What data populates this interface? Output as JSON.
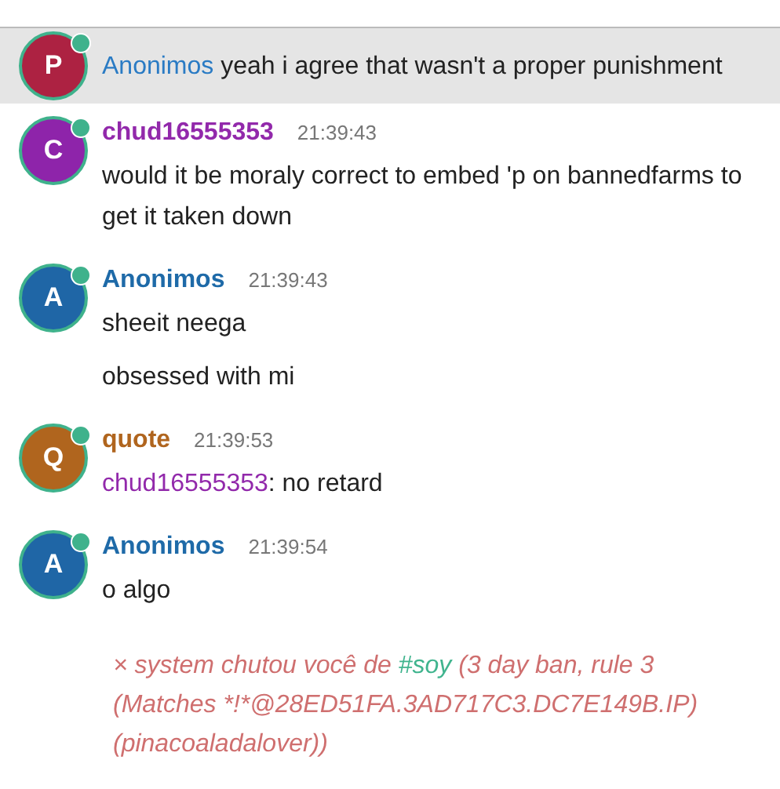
{
  "messages": [
    {
      "kind": "message",
      "highlighted": true,
      "avatar": {
        "letter": "P",
        "color": "#ad2242"
      },
      "online": true,
      "lines": [
        {
          "mention": {
            "name": "Anonimos",
            "color": "#2a7bc4"
          },
          "text": " yeah i agree that wasn't a proper punishment"
        }
      ]
    },
    {
      "kind": "message",
      "highlighted": false,
      "author": {
        "name": "chud16555353",
        "color": "#9229ab"
      },
      "avatar": {
        "letter": "C",
        "color": "#8e24aa"
      },
      "online": true,
      "time": "21:39:43",
      "lines": [
        {
          "text": "would it be moraly correct to embed 'p on bannedfarms to get it taken down"
        }
      ]
    },
    {
      "kind": "message",
      "highlighted": false,
      "author": {
        "name": "Anonimos",
        "color": "#1e6aa8"
      },
      "avatar": {
        "letter": "A",
        "color": "#1f66a6"
      },
      "online": true,
      "time": "21:39:43",
      "lines": [
        {
          "text": "sheeit neega"
        },
        {
          "text": "obsessed with mi"
        }
      ]
    },
    {
      "kind": "message",
      "highlighted": false,
      "author": {
        "name": "quote",
        "color": "#b0651e"
      },
      "avatar": {
        "letter": "Q",
        "color": "#b0651e"
      },
      "online": true,
      "time": "21:39:53",
      "lines": [
        {
          "mention": {
            "name": "chud16555353",
            "color": "#9229ab"
          },
          "text": ": no retard"
        }
      ]
    },
    {
      "kind": "message",
      "highlighted": false,
      "author": {
        "name": "Anonimos",
        "color": "#1e6aa8"
      },
      "avatar": {
        "letter": "A",
        "color": "#1f66a6"
      },
      "online": true,
      "time": "21:39:54",
      "lines": [
        {
          "text": "o algo"
        }
      ]
    },
    {
      "kind": "system",
      "before": "× system chutou você de ",
      "channel": "#soy",
      "after": " (3 day ban, rule 3 (Matches *!*@28ED51FA.3AD717C3.DC7E149B.IP) (pinacoaladalover))"
    }
  ]
}
